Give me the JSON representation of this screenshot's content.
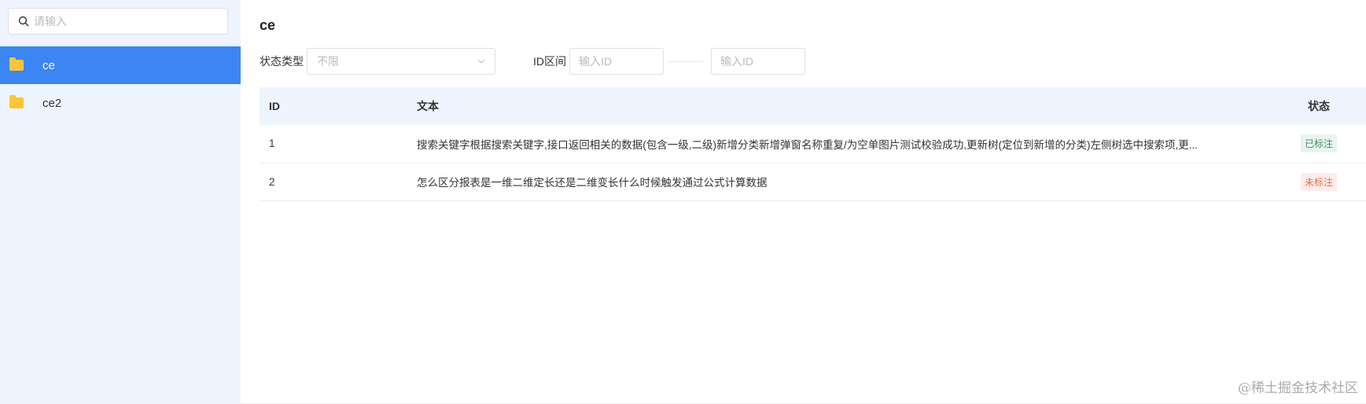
{
  "sidebar": {
    "search_placeholder": "请输入",
    "items": [
      {
        "label": "ce",
        "active": true
      },
      {
        "label": "ce2",
        "active": false
      }
    ]
  },
  "main": {
    "title": "ce",
    "filters": {
      "status_label": "状态类型",
      "status_value": "不限",
      "id_range_label": "ID区间",
      "id_from_placeholder": "输入ID",
      "id_to_placeholder": "输入ID"
    },
    "table": {
      "headers": [
        "ID",
        "文本",
        "状态"
      ],
      "rows": [
        {
          "id": "1",
          "text": "搜索关键字根据搜索关键字,接口返回相关的数据(包含一级,二级)新增分类新增弹窗名称重复/为空单图片测试校验成功,更新树(定位到新增的分类)左侧树选中搜索项,更...",
          "status": "已标注"
        },
        {
          "id": "2",
          "text": "怎么区分报表是一维二维定长还是二维变长什么时候触发通过公式计算数据",
          "status": "未标注"
        }
      ]
    }
  },
  "colors": {
    "accent": "#3b86f3",
    "labeled_bg": "#e8f5ee",
    "labeled_fg": "#4a8a6a",
    "unlabeled_bg": "#fdecec",
    "unlabeled_fg": "#e0724a"
  },
  "watermark": "@稀土掘金技术社区"
}
